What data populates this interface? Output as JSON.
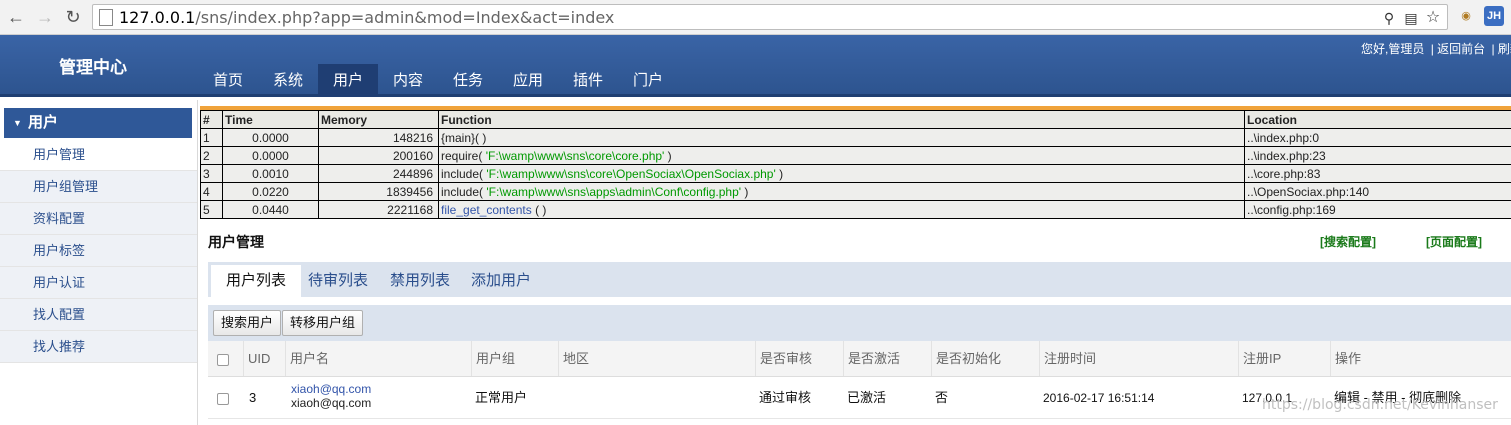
{
  "browser": {
    "url_host": "127.0.0.1",
    "url_path": "/sns/index.php?app=admin&mod=Index&act=index",
    "profile_badge": "JH"
  },
  "header": {
    "brand": "管理中心",
    "top_links": [
      "您好,管理员",
      "| 返回前台",
      "| 刷新"
    ],
    "nav": [
      "首页",
      "系统",
      "用户",
      "内容",
      "任务",
      "应用",
      "插件",
      "门户"
    ],
    "nav_active_index": 2
  },
  "sidebar": {
    "title": "用户",
    "items": [
      "用户管理",
      "用户组管理",
      "资料配置",
      "用户标签",
      "用户认证",
      "找人配置",
      "找人推荐"
    ],
    "active_index": 0
  },
  "debug": {
    "headers": [
      "#",
      "Time",
      "Memory",
      "Function",
      "Location"
    ],
    "rows": [
      {
        "n": "1",
        "time": "0.0000",
        "mem": "148216",
        "fn": "{main}",
        "arg": "",
        "suffix": "( )",
        "loc": "..\\index.php:0"
      },
      {
        "n": "2",
        "time": "0.0000",
        "mem": "200160",
        "fn": "require(",
        "arg": "'F:\\wamp\\www\\sns\\core\\core.php'",
        "suffix": " )",
        "loc": "..\\index.php:23"
      },
      {
        "n": "3",
        "time": "0.0010",
        "mem": "244896",
        "fn": "include(",
        "arg": "'F:\\wamp\\www\\sns\\core\\OpenSociax\\OpenSociax.php'",
        "suffix": " )",
        "loc": "..\\core.php:83"
      },
      {
        "n": "4",
        "time": "0.0220",
        "mem": "1839456",
        "fn": "include(",
        "arg": "'F:\\wamp\\www\\sns\\apps\\admin\\Conf\\config.php'",
        "suffix": " )",
        "loc": "..\\OpenSociax.php:140"
      },
      {
        "n": "5",
        "time": "0.0440",
        "mem": "2221168",
        "fn": "file_get_contents",
        "arg": "",
        "suffix": " ( )",
        "loc": "..\\config.php:169"
      }
    ]
  },
  "page": {
    "title": "用户管理",
    "search_config": "[搜索配置]",
    "page_config": "[页面配置]",
    "tabs": [
      "用户列表",
      "待审列表",
      "禁用列表",
      "添加用户"
    ],
    "tab_active_index": 0,
    "buttons": [
      "搜索用户",
      "转移用户组"
    ]
  },
  "grid": {
    "headers": [
      "UID",
      "用户名",
      "用户组",
      "地区",
      "是否审核",
      "是否激活",
      "是否初始化",
      "注册时间",
      "注册IP",
      "操作"
    ],
    "rows": [
      {
        "uid": "3",
        "email_link": "xiaoh@qq.com",
        "email_text": "xiaoh@qq.com",
        "group": "正常用户",
        "region": "",
        "audit": "通过审核",
        "active": "已激活",
        "init": "否",
        "reg_time": "2016-02-17 16:51:14",
        "reg_ip": "127.0.0.1",
        "ops": "编辑 - 禁用 - 彻底删除"
      }
    ]
  },
  "watermark": "https://blog.csdn.net/Kevinhanser",
  "colors": {
    "header_blue": "#2d548f",
    "debug_orange": "#f0a33a",
    "config_green": "#1a7a1a",
    "link_blue": "#1a3f8c"
  }
}
